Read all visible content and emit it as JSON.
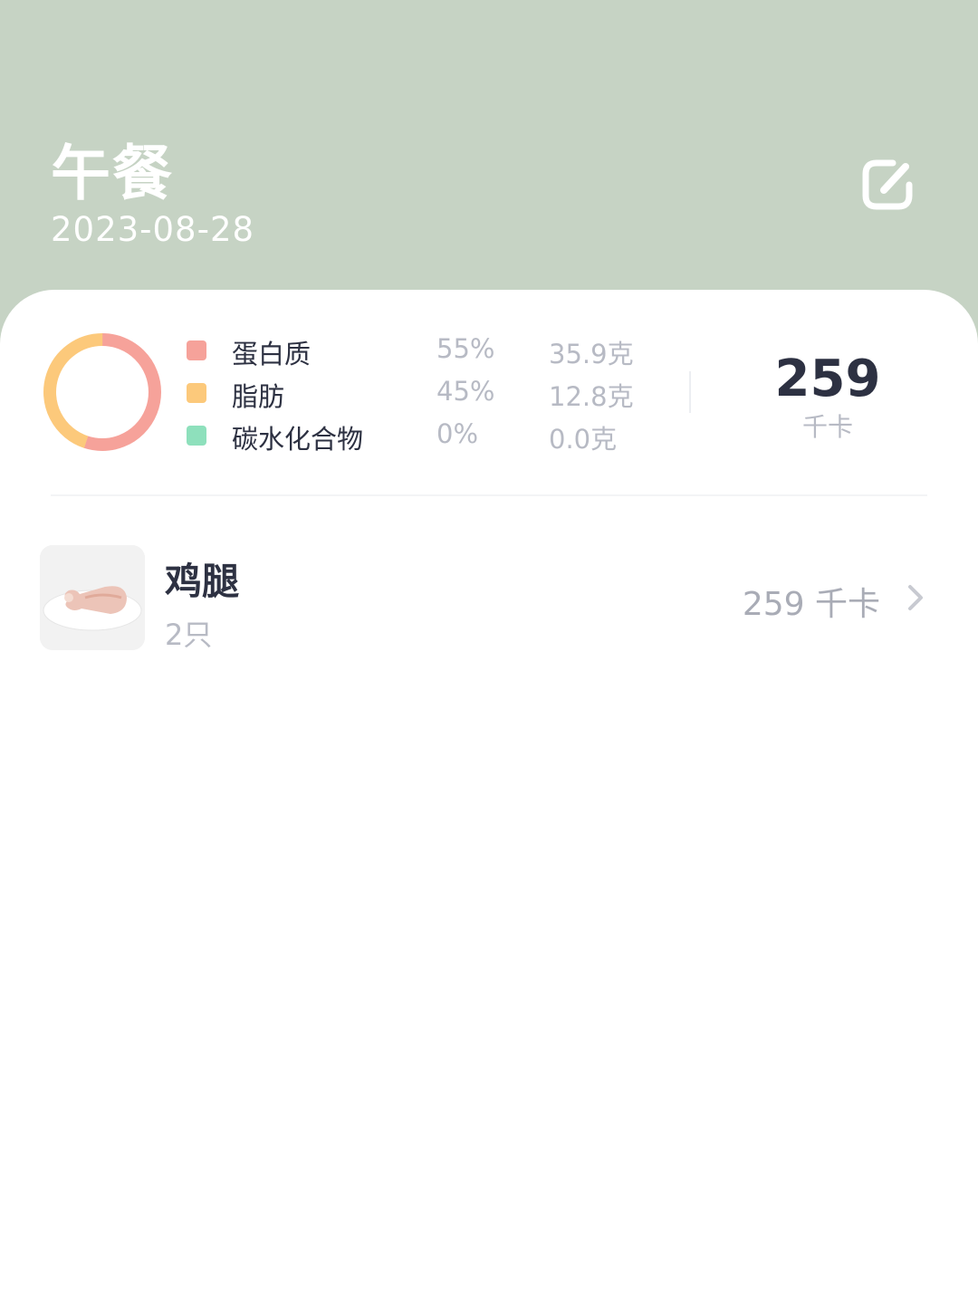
{
  "header": {
    "meal_title": "午餐",
    "date": "2023-08-28",
    "edit_icon": "edit-icon",
    "background_color": "#c6d3c4"
  },
  "macros": {
    "items": [
      {
        "name": "蛋白质",
        "percent": "55%",
        "amount": "35.9克",
        "color": "#f6a29a"
      },
      {
        "name": "脂肪",
        "percent": "45%",
        "amount": "12.8克",
        "color": "#fcc97b"
      },
      {
        "name": "碳水化合物",
        "percent": "0%",
        "amount": "0.0克",
        "color": "#8ee0bc"
      }
    ],
    "total_kcal": "259",
    "total_unit": "千卡"
  },
  "foods": [
    {
      "name": "鸡腿",
      "quantity": "2只",
      "kcal": "259 千卡",
      "thumb_icon": "chicken-leg-photo",
      "chevron_icon": "chevron-right-icon"
    }
  ]
}
